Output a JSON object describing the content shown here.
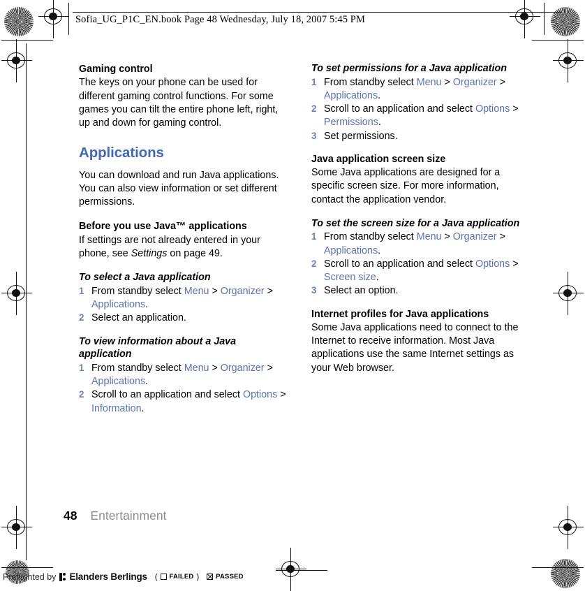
{
  "header": {
    "text": "Sofia_UG_P1C_EN.book  Page 48  Wednesday, July 18, 2007  5:45 PM"
  },
  "colors": {
    "heading_blue": "#4169b8",
    "link_blue": "#5a72b8",
    "step_number_blue": "#6a7fbf",
    "footer_gray": "#8b8b8b"
  },
  "left_column": {
    "gaming": {
      "heading": "Gaming control",
      "body": "The keys on your phone can be used for different gaming control functions. For some games you can tilt the entire phone left, right, up and down for gaming control."
    },
    "applications": {
      "heading": "Applications",
      "intro": "You can download and run Java applications. You can also view information or set different permissions.",
      "before": {
        "heading": "Before you use Java™ applications",
        "body_pre": "If settings are not already entered in your phone, see ",
        "body_em": "Settings",
        "body_post": " on page 49."
      },
      "select_proc": {
        "heading": "To select a Java application",
        "steps": [
          {
            "pre": "From standby select ",
            "links": [
              "Menu",
              "Organizer",
              "Applications"
            ],
            "rendered": "From standby select Menu > Organizer > Applications."
          },
          {
            "pre": "Select an application.",
            "rendered": "Select an application."
          }
        ]
      },
      "view_info_proc": {
        "heading": "To view information about a Java application",
        "steps": [
          {
            "pre": "From standby select ",
            "links": [
              "Menu",
              "Organizer",
              "Applications"
            ],
            "rendered": "From standby select Menu > Organizer > Applications."
          },
          {
            "pre": "Scroll to an application and select ",
            "links": [
              "Options",
              "Information"
            ],
            "rendered": "Scroll to an application and select Options > Information."
          }
        ]
      }
    }
  },
  "right_column": {
    "permissions_proc": {
      "heading": "To set permissions for a Java application",
      "steps": [
        {
          "pre": "From standby select ",
          "links": [
            "Menu",
            "Organizer",
            "Applications"
          ],
          "rendered": "From standby select Menu > Organizer > Applications."
        },
        {
          "pre": "Scroll to an application and select ",
          "links": [
            "Options",
            "Permissions"
          ],
          "rendered": "Scroll to an application and select Options > Permissions."
        },
        {
          "pre": "Set permissions.",
          "rendered": "Set permissions."
        }
      ]
    },
    "screen_size": {
      "heading": "Java application screen size",
      "body": "Some Java applications are designed for a specific screen size. For more information, contact the application vendor."
    },
    "screen_size_proc": {
      "heading": "To set the screen size for a Java application",
      "steps": [
        {
          "pre": "From standby select ",
          "links": [
            "Menu",
            "Organizer",
            "Applications"
          ],
          "rendered": "From standby select Menu > Organizer > Applications."
        },
        {
          "pre": "Scroll to an application and select ",
          "links": [
            "Options",
            "Screen size"
          ],
          "rendered": "Scroll to an application and select Options > Screen size."
        },
        {
          "pre": "Select an option.",
          "rendered": "Select an option."
        }
      ]
    },
    "internet_profiles": {
      "heading": "Internet profiles for Java applications",
      "body": "Some Java applications need to connect to the Internet to receive information. Most Java applications use the same Internet settings as your Web browser."
    }
  },
  "footer": {
    "page_number": "48",
    "page_title": "Entertainment"
  },
  "preflight": {
    "by_text": "Preflighted by",
    "brand": "Elanders Berlings",
    "open_paren": "(",
    "failed_label": "FAILED",
    "close_paren": ")",
    "passed_label": "PASSED"
  },
  "text_tokens": {
    "menu": "Menu",
    "organizer": "Organizer",
    "applications": "Applications",
    "options": "Options",
    "information": "Information",
    "permissions": "Permissions",
    "screen_size": "Screen size",
    "gt": ">",
    "period": ".",
    "from_standby_select": "From standby select ",
    "scroll_select": "Scroll to an application and select ",
    "select_application": "Select an application.",
    "set_permissions": "Set permissions.",
    "select_option": "Select an option."
  }
}
